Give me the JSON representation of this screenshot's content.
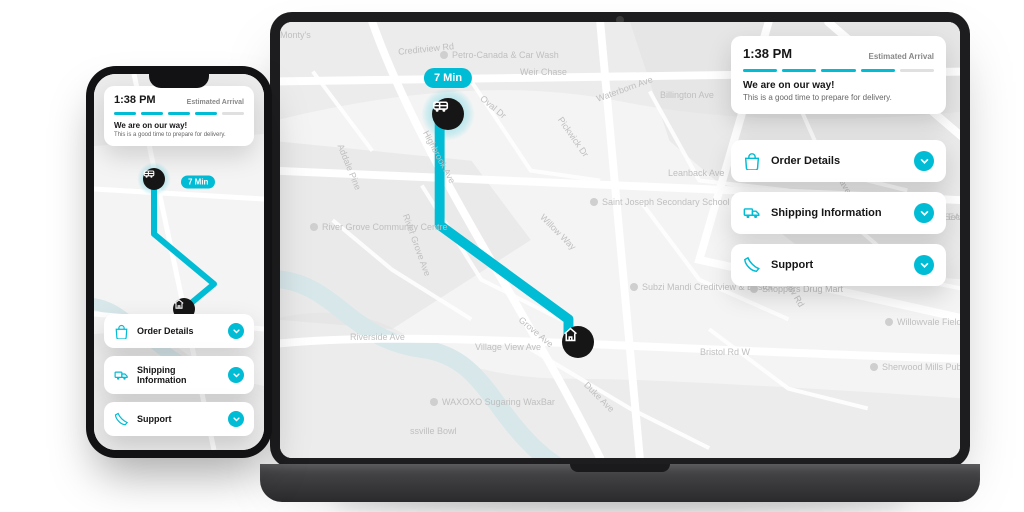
{
  "status": {
    "time": "1:38 PM",
    "eta_label": "Estimated Arrival",
    "headline": "We are on our way!",
    "subline": "This is a good time to prepare for delivery.",
    "progress_total": 5,
    "progress_done": 4
  },
  "eta_badge": "7 Min",
  "actions": {
    "order": "Order Details",
    "shipping": "Shipping Information",
    "support": "Support"
  },
  "map_pois": {
    "a": "Petro-Canada & Car Wash",
    "b": "River Grove Community Centre",
    "c": "Saint Joseph Secondary School",
    "d": "Subzi Mandi Creditview & Bristol",
    "e": "Shoppers Drug Mart",
    "f": "Sherwood Mills Public School",
    "g": "Willowvale Fields",
    "h": "WAXOXO Sugaring WaxBar",
    "i": "East Hare Secondary",
    "j": "Monty's",
    "k": "ssville Bowl",
    "l": "EAS"
  },
  "map_streets": {
    "a": "Creditview Rd",
    "b": "Bristol Rd W",
    "c": "River Grove Ave",
    "d": "Grove Ave",
    "e": "Highbrook Ave",
    "f": "Oval Dr",
    "g": "Pickwick Dr",
    "h": "Weir Chase",
    "i": "Waterborn Ave",
    "j": "Billington Ave",
    "k": "Leanback Ave",
    "l": "Duke Ave",
    "m": "Riverside Ave",
    "n": "Addale Pine",
    "o": "Creditview Rd",
    "p": "Village View Ave",
    "q": "Willow Way",
    "r": "Musgrave Rd"
  },
  "colors": {
    "accent": "#00bcd4",
    "ink": "#161616"
  }
}
